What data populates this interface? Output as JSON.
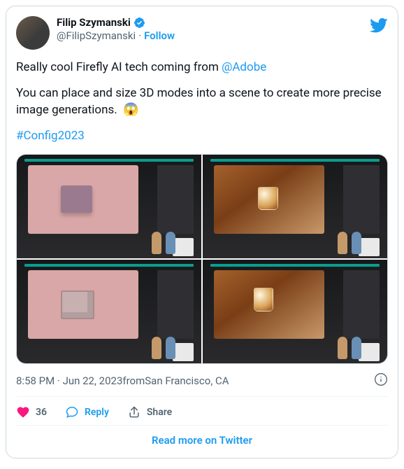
{
  "author": {
    "name": "Filip Szymanski",
    "handle": "@FilipSzymanski",
    "follow_label": "Follow"
  },
  "tweet": {
    "line1_pre": "Really cool Firefly AI tech coming from ",
    "line1_mention": "@Adobe",
    "line2": "You can place and size 3D modes into a scene to create more precise image generations.",
    "line2_emoji": "😱",
    "hashtag": "#Config2023"
  },
  "media": {
    "count": 4,
    "alt": [
      "presentation slide 1",
      "presentation slide 2",
      "presentation slide 3",
      "presentation slide 4"
    ]
  },
  "meta": {
    "time": "8:58 PM",
    "sep1": " · ",
    "date": "Jun 22, 2023",
    "from_label": " from ",
    "location": "San Francisco, CA"
  },
  "actions": {
    "like_count": "36",
    "reply_label": "Reply",
    "share_label": "Share"
  },
  "footer": {
    "read_more": "Read more on Twitter"
  }
}
